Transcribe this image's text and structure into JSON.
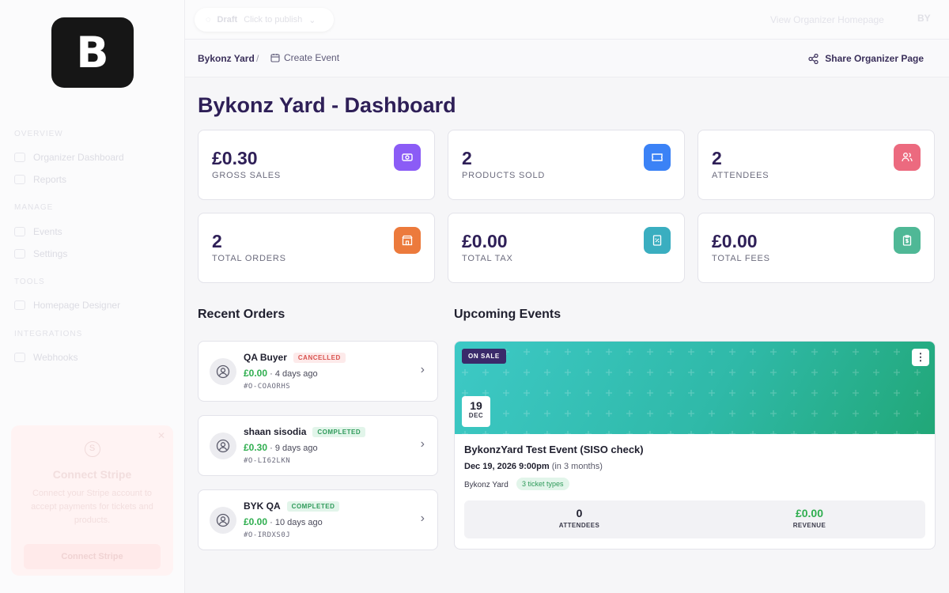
{
  "sidebar": {
    "logo_letter": "B",
    "sections": [
      {
        "title": "Overview",
        "items": [
          "Organizer Dashboard",
          "Reports"
        ]
      },
      {
        "title": "Manage",
        "items": [
          "Events",
          "Settings"
        ]
      },
      {
        "title": "Tools",
        "items": [
          "Homepage Designer"
        ]
      },
      {
        "title": "Integrations",
        "items": [
          "Webhooks"
        ]
      }
    ],
    "stripe": {
      "title": "Connect Stripe",
      "text": "Connect your Stripe account to accept payments for tickets and products.",
      "button_label": "Connect Stripe"
    }
  },
  "topbar": {
    "status_label": "Draft",
    "status_hint": "Click to publish",
    "view_homepage_label": "View Organizer Homepage",
    "avatar_initials": "BY"
  },
  "breadcrumb": {
    "home": "Bykonz Yard",
    "separator": "/",
    "current": "Create Event"
  },
  "share_label": "Share Organizer Page",
  "page_title": "Bykonz Yard - Dashboard",
  "stats": [
    {
      "value": "£0.30",
      "label": "GROSS SALES",
      "color": "#8b5cf6",
      "icon": "cash-icon"
    },
    {
      "value": "2",
      "label": "PRODUCTS SOLD",
      "color": "#3b82f6",
      "icon": "ticket-icon"
    },
    {
      "value": "2",
      "label": "ATTENDEES",
      "color": "#ec6a7f",
      "icon": "users-icon"
    },
    {
      "value": "2",
      "label": "TOTAL ORDERS",
      "color": "#ec7a3c",
      "icon": "building-icon"
    },
    {
      "value": "£0.00",
      "label": "TOTAL TAX",
      "color": "#3aaec0",
      "icon": "receipt-icon"
    },
    {
      "value": "£0.00",
      "label": "TOTAL FEES",
      "color": "#4fb896",
      "icon": "clipboard-icon"
    }
  ],
  "recent_orders": {
    "title": "Recent Orders",
    "items": [
      {
        "name": "QA Buyer",
        "status": "CANCELLED",
        "amount": "£0.00",
        "time": "4 days ago",
        "id": "#O-COAORHS"
      },
      {
        "name": "shaan sisodia",
        "status": "COMPLETED",
        "amount": "£0.30",
        "time": "9 days ago",
        "id": "#O-LI62LKN"
      },
      {
        "name": "BYK QA",
        "status": "COMPLETED",
        "amount": "£0.00",
        "time": "10 days ago",
        "id": "#O-IRDXS0J"
      }
    ]
  },
  "upcoming_events": {
    "title": "Upcoming Events",
    "event": {
      "status": "ON SALE",
      "day": "19",
      "month": "DEC",
      "title": "BykonzYard Test Event (SISO check)",
      "datetime": "Dec 19, 2026 9:00pm",
      "relative": "(in 3 months)",
      "organizer": "Bykonz Yard",
      "ticket_types": "3 ticket types",
      "attendees_value": "0",
      "attendees_label": "ATTENDEES",
      "revenue_value": "£0.00",
      "revenue_label": "REVENUE",
      "more_label": "⋮"
    }
  },
  "colors": {
    "brand": "#2e1f57",
    "positive": "#2fae4f",
    "banner_start": "#3dc9c6",
    "banner_end": "#21a777"
  }
}
